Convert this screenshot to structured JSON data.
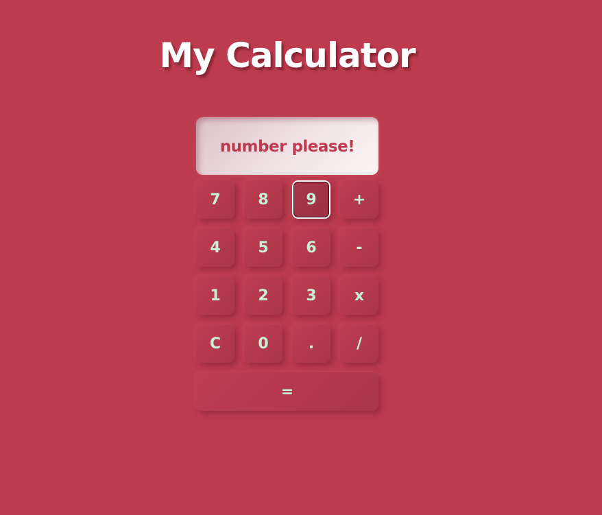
{
  "page": {
    "title": "My Calculator"
  },
  "display": {
    "text": "number please!"
  },
  "keys": {
    "row1": [
      "7",
      "8",
      "9",
      "+"
    ],
    "row2": [
      "4",
      "5",
      "6",
      "-"
    ],
    "row3": [
      "1",
      "2",
      "3",
      "x"
    ],
    "row4": [
      "C",
      "0",
      ".",
      "/"
    ],
    "equals": "="
  },
  "colors": {
    "background": "#bc3b4f",
    "key_text": "#c8f0d6",
    "display_text": "#bc3b4f",
    "title_text": "#ffffff"
  }
}
